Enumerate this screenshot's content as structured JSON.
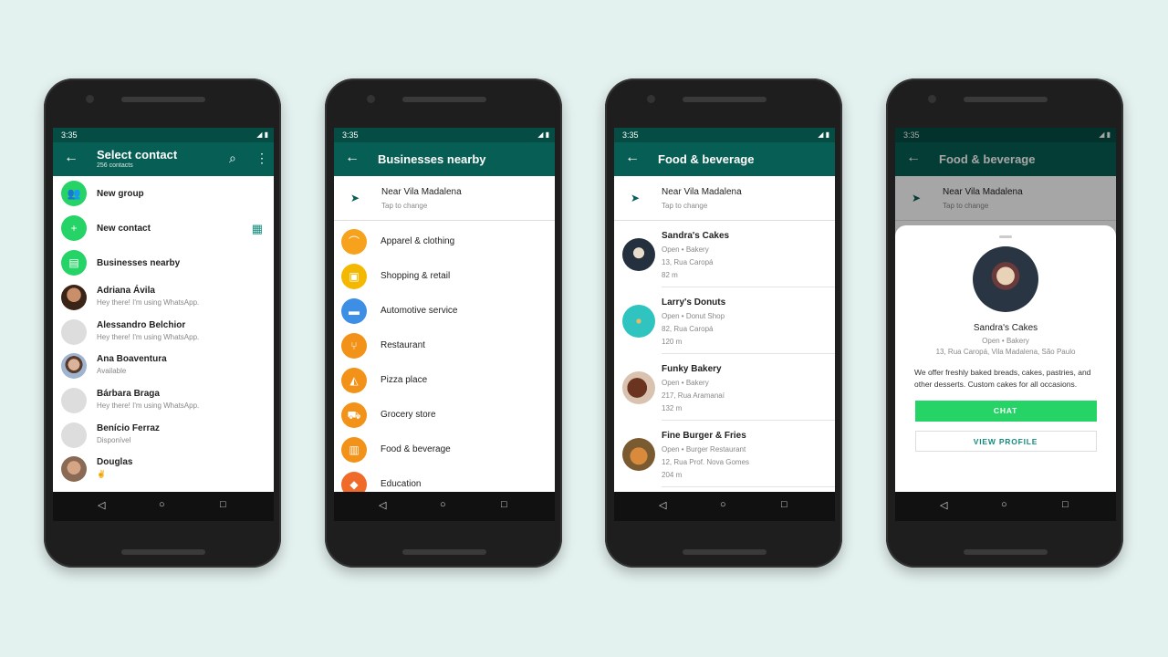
{
  "colors": {
    "header": "#075e54",
    "status": "#054d44",
    "accent": "#25d366",
    "background": "#e3f1ef"
  },
  "status_time": "3:35",
  "phones": [
    {
      "header": {
        "title": "Select contact",
        "subtitle": "256 contacts"
      },
      "actions": [
        {
          "label": "New group",
          "icon": "group-icon"
        },
        {
          "label": "New contact",
          "icon": "add-person-icon"
        },
        {
          "label": "Businesses nearby",
          "icon": "store-icon"
        }
      ],
      "contacts": [
        {
          "name": "Adriana Ávila",
          "status": "Hey there! I'm using WhatsApp.",
          "photo": true
        },
        {
          "name": "Alessandro Belchior",
          "status": "Hey there! I'm using WhatsApp.",
          "photo": false
        },
        {
          "name": "Ana Boaventura",
          "status": "Available",
          "photo": true
        },
        {
          "name": "Bárbara Braga",
          "status": "Hey there! I'm using WhatsApp.",
          "photo": false
        },
        {
          "name": "Benício Ferraz",
          "status": "Disponível",
          "photo": false
        },
        {
          "name": "Douglas",
          "status": "✌",
          "photo": true
        }
      ]
    },
    {
      "header": {
        "title": "Businesses nearby"
      },
      "location": {
        "title": "Near Vila Madalena",
        "subtitle": "Tap to change"
      },
      "categories": [
        {
          "label": "Apparel & clothing",
          "icon": "hanger-icon",
          "color": "#f6a21c"
        },
        {
          "label": "Shopping & retail",
          "icon": "shopping-bag-icon",
          "color": "#f5b800"
        },
        {
          "label": "Automotive service",
          "icon": "car-icon",
          "color": "#3d8ee5"
        },
        {
          "label": "Restaurant",
          "icon": "fork-knife-icon",
          "color": "#f39218"
        },
        {
          "label": "Pizza place",
          "icon": "pizza-icon",
          "color": "#f39218"
        },
        {
          "label": "Grocery store",
          "icon": "cart-icon",
          "color": "#f39218"
        },
        {
          "label": "Food & beverage",
          "icon": "food-icon",
          "color": "#f39218"
        },
        {
          "label": "Education",
          "icon": "graduation-cap-icon",
          "color": "#f06a2a"
        }
      ]
    },
    {
      "header": {
        "title": "Food & beverage"
      },
      "location": {
        "title": "Near Vila Madalena",
        "subtitle": "Tap to change"
      },
      "businesses": [
        {
          "name": "Sandra's Cakes",
          "type": "Open • Bakery",
          "address": "13, Rua Caropá",
          "distance": "82 m"
        },
        {
          "name": "Larry's Donuts",
          "type": "Open • Donut Shop",
          "address": "82, Rua Caropá",
          "distance": "120 m"
        },
        {
          "name": "Funky Bakery",
          "type": "Open • Bakery",
          "address": "217, Rua Aramanaí",
          "distance": "132 m"
        },
        {
          "name": "Fine Burger & Fries",
          "type": "Open • Burger Restaurant",
          "address": "12, Rua Prof. Nova Gomes",
          "distance": "204 m"
        }
      ]
    },
    {
      "header": {
        "title": "Food & beverage"
      },
      "location": {
        "title": "Near Vila Madalena",
        "subtitle": "Tap to change"
      },
      "profile": {
        "name": "Sandra's Cakes",
        "type": "Open • Bakery",
        "address": "13, Rua Caropá, Vila Madalena, São Paulo",
        "description": "We offer freshly baked breads, cakes, pastries, and other desserts. Custom cakes for all occasions.",
        "chat_label": "CHAT",
        "view_profile_label": "VIEW PROFILE"
      }
    }
  ]
}
